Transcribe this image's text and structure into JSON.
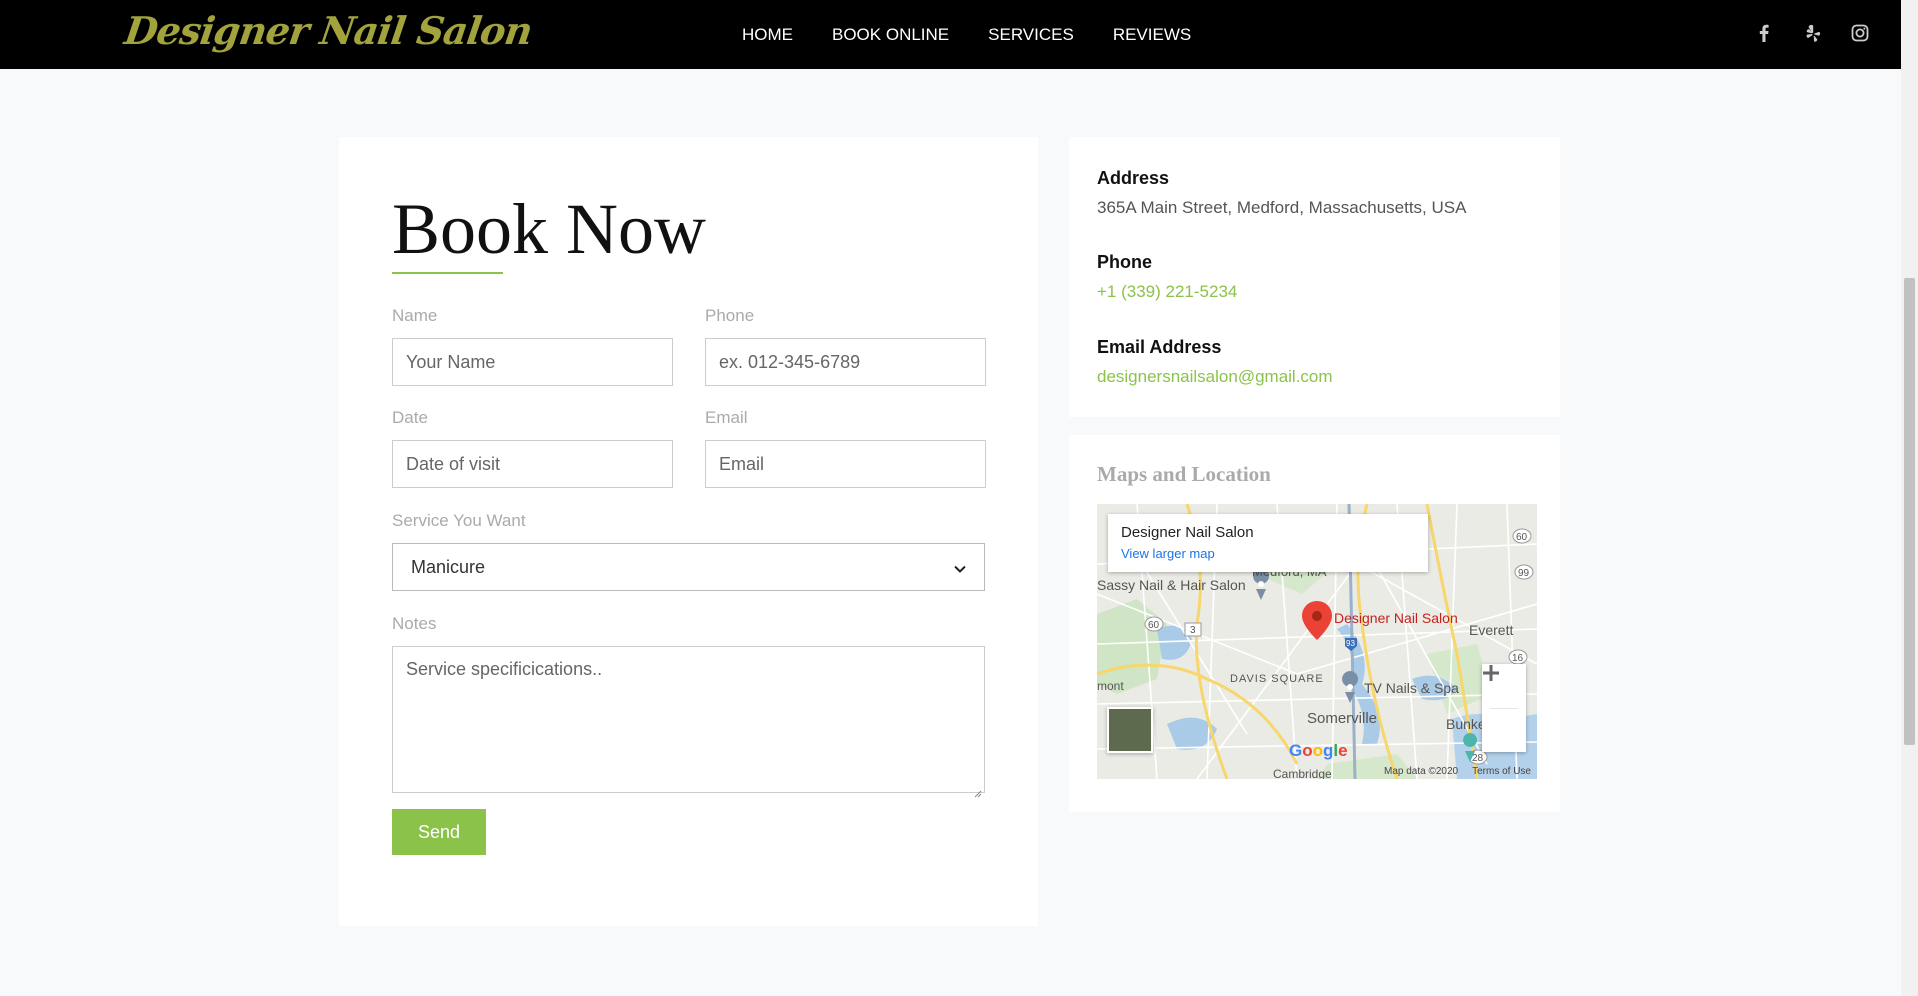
{
  "brand": {
    "name": "Designer Nail Salon"
  },
  "nav": {
    "items": [
      "HOME",
      "BOOK ONLINE",
      "SERVICES",
      "REVIEWS"
    ],
    "social": [
      "facebook-icon",
      "yelp-icon",
      "instagram-icon"
    ]
  },
  "booking": {
    "title": "Book Now",
    "name_label": "Name",
    "name_placeholder": "Your Name",
    "phone_label": "Phone",
    "phone_placeholder": "ex. 012-345-6789",
    "date_label": "Date",
    "date_placeholder": "Date of visit",
    "email_label": "Email",
    "email_placeholder": "Email",
    "service_label": "Service You Want",
    "service_selected": "Manicure",
    "notes_label": "Notes",
    "notes_placeholder": "Service specificications..",
    "send_label": "Send"
  },
  "contact": {
    "address_label": "Address",
    "address_value": "365A Main Street, Medford, Massachusetts, USA",
    "phone_label": "Phone",
    "phone_value": "+1 (339) 221-5234",
    "email_label": "Email Address",
    "email_value": "designersnailsalon@gmail.com"
  },
  "map": {
    "title": "Maps and Location",
    "info_name": "Designer Nail Salon",
    "info_link": "View larger map",
    "pin_label": "Designer Nail Salon",
    "labels": {
      "medford": "Medford, MA",
      "sassy": "Sassy Nail & Hair Salon",
      "everett": "Everett",
      "davis": "DAVIS SQUARE",
      "tv": "TV Nails & Spa",
      "somerville": "Somerville",
      "bunker": "Bunker Hi",
      "belmont": "mont",
      "cambridge": "Cambridge"
    },
    "google": "Google",
    "map_data": "Map data ©2020",
    "terms": "Terms of Use",
    "accent": "#8bc34a",
    "pin_color": "#ea4335"
  }
}
